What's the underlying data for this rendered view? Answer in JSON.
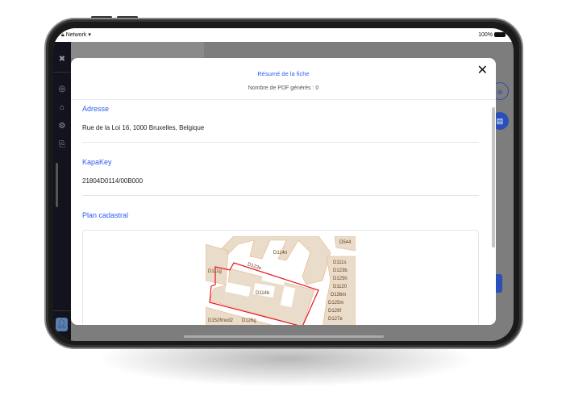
{
  "status_bar": {
    "network": "Network",
    "battery": "100%"
  },
  "sidebar": {
    "icons": [
      "close-icon",
      "badge-icon",
      "home-icon",
      "settings-icon",
      "document-sync-icon"
    ],
    "avatar_icon": "user-icon"
  },
  "modal": {
    "title": "Résumé de la fiche",
    "subtitle": "Nombre de PDF générés : 0",
    "sections": [
      {
        "heading": "Adresse",
        "value": "Rue de la Loi 16, 1000 Bruxelles, Belgique"
      },
      {
        "heading": "KapaKey",
        "value": "21804D0114/00B000"
      },
      {
        "heading": "Plan cadastral"
      }
    ],
    "map_labels": [
      "D114n",
      "D123e",
      "D111g",
      "D114b",
      "D111s",
      "D123b",
      "D125h",
      "D1120",
      "D136m",
      "D125m",
      "D129f",
      "D127e",
      "D152fmod2",
      "D126g",
      "D544"
    ]
  },
  "colors": {
    "accent": "#2d5cf0",
    "fab": "#2a4fb8",
    "parcel_outline": "#e8141e",
    "map_fill": "#e9dccb"
  }
}
